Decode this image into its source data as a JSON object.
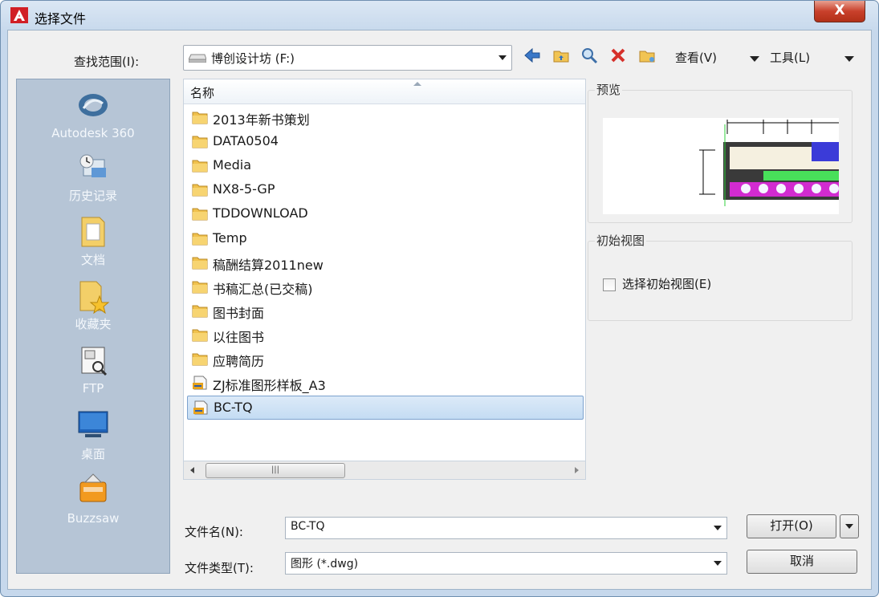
{
  "window": {
    "title": "选择文件",
    "close_label": "X"
  },
  "toolbar": {
    "look_in_label": "查找范围(I):",
    "look_in_value": "博创设计坊 (F:)",
    "view_label": "查看(V)",
    "tools_label": "工具(L)"
  },
  "places": [
    {
      "label": "Autodesk 360",
      "icon": "autodesk-360-icon"
    },
    {
      "label": "历史记录",
      "icon": "history-icon"
    },
    {
      "label": "文档",
      "icon": "documents-icon"
    },
    {
      "label": "收藏夹",
      "icon": "favorites-icon"
    },
    {
      "label": "FTP",
      "icon": "ftp-icon"
    },
    {
      "label": "桌面",
      "icon": "desktop-icon"
    },
    {
      "label": "Buzzsaw",
      "icon": "buzzsaw-icon"
    }
  ],
  "file_list": {
    "column_name": "名称",
    "items": [
      {
        "name": "2013年新书策划",
        "type": "folder"
      },
      {
        "name": "DATA0504",
        "type": "folder"
      },
      {
        "name": "Media",
        "type": "folder"
      },
      {
        "name": "NX8-5-GP",
        "type": "folder"
      },
      {
        "name": "TDDOWNLOAD",
        "type": "folder"
      },
      {
        "name": "Temp",
        "type": "folder"
      },
      {
        "name": "稿酬结算2011new",
        "type": "folder"
      },
      {
        "name": "书稿汇总(已交稿)",
        "type": "folder"
      },
      {
        "name": "图书封面",
        "type": "folder"
      },
      {
        "name": "以往图书",
        "type": "folder"
      },
      {
        "name": "应聘简历",
        "type": "folder"
      },
      {
        "name": "ZJ标准图形样板_A3",
        "type": "dwg"
      },
      {
        "name": "BC-TQ",
        "type": "dwg",
        "selected": true
      }
    ]
  },
  "preview": {
    "label": "预览"
  },
  "initial_view": {
    "label": "初始视图",
    "checkbox_label": "选择初始视图(E)"
  },
  "filename": {
    "label": "文件名(N):",
    "value": "BC-TQ"
  },
  "filetype": {
    "label": "文件类型(T):",
    "value": "图形 (*.dwg)"
  },
  "buttons": {
    "open": "打开(O)",
    "cancel": "取消"
  },
  "colors": {
    "title_bg": "#c6d8ec",
    "places_bg": "#b6c5d6",
    "selection": "#c4dcf3",
    "close": "#c9402b"
  }
}
